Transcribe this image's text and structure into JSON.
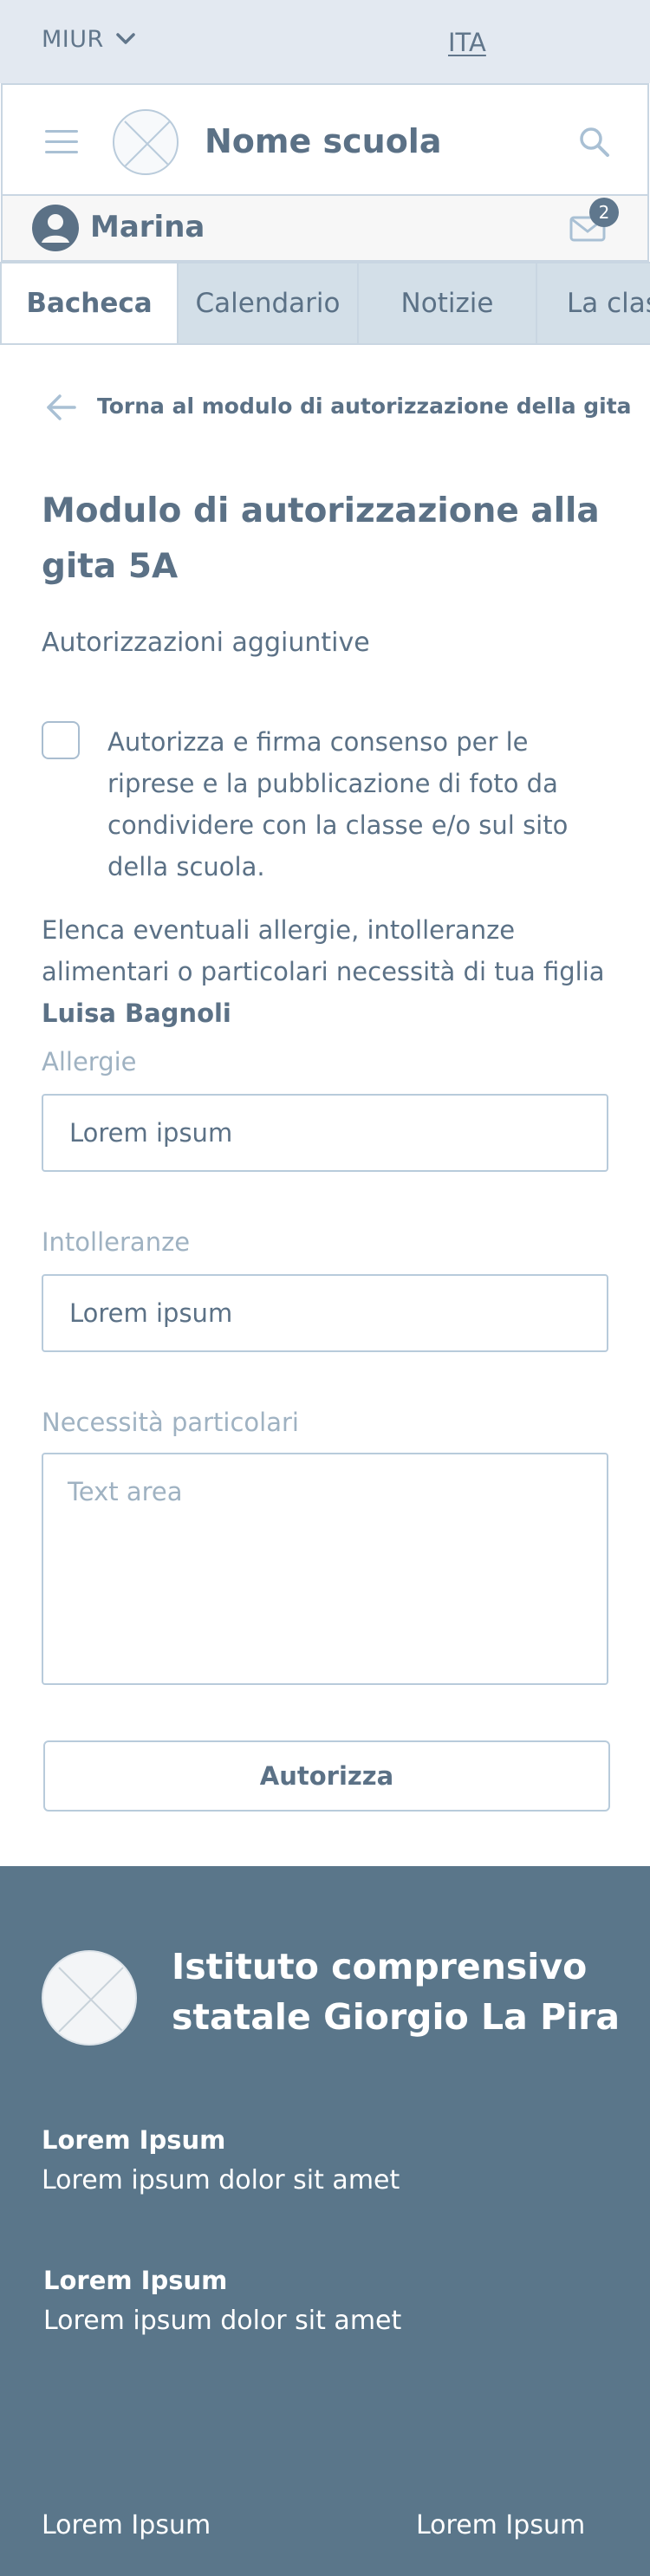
{
  "topbar": {
    "org": "MIUR",
    "language": "ITA"
  },
  "header": {
    "school_name": "Nome scuola"
  },
  "user": {
    "name": "Marina",
    "unread_count": "2"
  },
  "tabs": [
    {
      "label": "Bacheca",
      "active": true
    },
    {
      "label": "Calendario"
    },
    {
      "label": "Notizie"
    },
    {
      "label": "La classe"
    }
  ],
  "back_link": "Torna al modulo di autorizzazione della gita",
  "form": {
    "title": "Modulo di autorizzazione alla gita 5A",
    "subtitle": "Autorizzazioni aggiuntive",
    "consent_text": "Autorizza e firma consenso per le riprese e la pubblicazione di foto da condividere con la classe e/o sul sito della scuola.",
    "allergy_intro": "Elenca eventuali allergie, intolleranze alimentari o particolari necessità di tua figlia",
    "child_name": "Luisa Bagnoli",
    "allergie_label": "Allergie",
    "allergie_value": "Lorem ipsum",
    "intolleranze_label": "Intolleranze",
    "intolleranze_value": "Lorem ipsum",
    "necessita_label": "Necessità particolari",
    "necessita_placeholder": "Text area",
    "submit_label": "Autorizza"
  },
  "footer": {
    "institute_name": "Istituto comprensivo statale Giorgio La Pira",
    "blocks": [
      {
        "heading": "Lorem Ipsum",
        "text": "Lorem ipsum dolor sit amet"
      },
      {
        "heading": "Lorem Ipsum",
        "text": "Lorem ipsum dolor sit amet"
      }
    ],
    "bottom_links": [
      "Lorem Ipsum",
      "Lorem Ipsum"
    ]
  },
  "colors": {
    "primary": "#5a768a",
    "text": "#5b7186",
    "muted": "#9fb2c2",
    "tab_bg": "#d3dfe8",
    "border": "#c9d6e2"
  }
}
